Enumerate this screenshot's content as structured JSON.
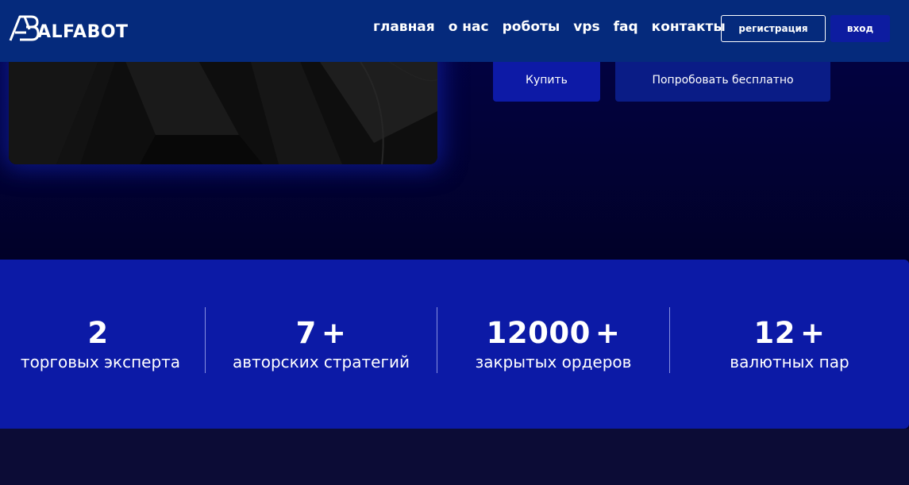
{
  "brand": {
    "logo_text": "ALFABOT"
  },
  "nav": {
    "items": [
      {
        "label": "главная"
      },
      {
        "label": "о нас"
      },
      {
        "label": "роботы"
      },
      {
        "label": "vps"
      },
      {
        "label": "faq"
      },
      {
        "label": "контакты"
      }
    ],
    "register_label": "регистрация",
    "login_label": "вход"
  },
  "hero": {
    "buy_label": "Купить",
    "trial_label": "Попробовать бесплатно"
  },
  "stats": [
    {
      "value": "2",
      "suffix": "",
      "label": "торговых эксперта"
    },
    {
      "value": "7",
      "suffix": "+",
      "label": "авторских стратегий"
    },
    {
      "value": "12000",
      "suffix": "+",
      "label": "закрытых ордеров"
    },
    {
      "value": "12",
      "suffix": "+",
      "label": "валютных пар"
    }
  ],
  "colors": {
    "header_bg": "#052a7c",
    "accent": "#0c1aa6",
    "page_bg": "#02022e"
  }
}
